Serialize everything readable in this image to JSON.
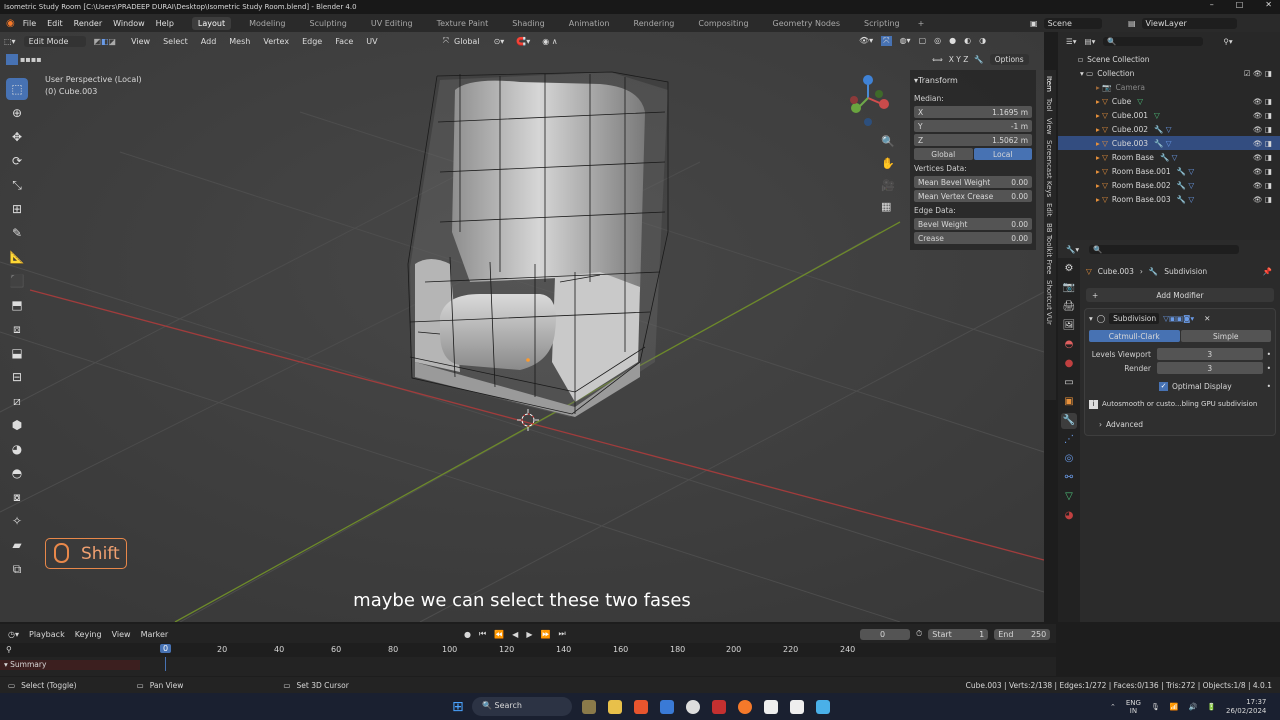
{
  "window": {
    "title": "Isometric Study Room [C:\\Users\\PRADEEP DURAI\\Desktop\\Isometric Study Room.blend] - Blender 4.0",
    "min": "–",
    "max": "□",
    "close": "✕"
  },
  "menu": [
    "File",
    "Edit",
    "Render",
    "Window",
    "Help"
  ],
  "workspaces": [
    "Layout",
    "Modeling",
    "Sculpting",
    "UV Editing",
    "Texture Paint",
    "Shading",
    "Animation",
    "Rendering",
    "Compositing",
    "Geometry Nodes",
    "Scripting"
  ],
  "scene": "Scene",
  "viewlayer": "ViewLayer",
  "viewport": {
    "mode": "Edit Mode",
    "menus": [
      "View",
      "Select",
      "Add",
      "Mesh",
      "Vertex",
      "Edge",
      "Face",
      "UV"
    ],
    "orientation": "Global",
    "perspective": "User Perspective (Local)",
    "object": "(0) Cube.003",
    "options": "Options",
    "axes": "X  Y  Z"
  },
  "transform": {
    "title": "Transform",
    "median": "Median:",
    "x_label": "X",
    "x": "1.1695 m",
    "y_label": "Y",
    "y": "-1 m",
    "z_label": "Z",
    "z": "1.5062 m",
    "global": "Global",
    "local": "Local",
    "vertices_data": "Vertices Data:",
    "mean_bevel": "Mean Bevel Weight",
    "mean_bevel_val": "0.00",
    "mean_crease": "Mean Vertex Crease",
    "mean_crease_val": "0.00",
    "edge_data": "Edge Data:",
    "bevel": "Bevel Weight",
    "bevel_val": "0.00",
    "crease": "Crease",
    "crease_val": "0.00"
  },
  "sidetabs": [
    "Item",
    "Tool",
    "View",
    "Screencast Keys",
    "Edit",
    "BB Toolkit Free",
    "Shortcut VUr"
  ],
  "outliner": {
    "root": "Scene Collection",
    "collection": "Collection",
    "items": [
      "Camera",
      "Cube",
      "Cube.001",
      "Cube.002",
      "Cube.003",
      "Room Base",
      "Room Base.001",
      "Room Base.002",
      "Room Base.003"
    ],
    "selected": "Cube.003"
  },
  "properties": {
    "object": "Cube.003",
    "modifier": "Subdivision",
    "add_modifier": "Add Modifier",
    "catmull": "Catmull-Clark",
    "simple": "Simple",
    "levels_label": "Levels Viewport",
    "levels": "3",
    "render_label": "Render",
    "render": "3",
    "optimal": "Optimal Display",
    "info": "Autosmooth or custo...bling GPU subdivision",
    "advanced": "Advanced"
  },
  "timeline": {
    "menus": [
      "Playback",
      "Keying",
      "View",
      "Marker"
    ],
    "frame": "0",
    "start_label": "Start",
    "start": "1",
    "end_label": "End",
    "end": "250",
    "ticks": [
      "0",
      "20",
      "40",
      "60",
      "80",
      "100",
      "120",
      "140",
      "160",
      "180",
      "200",
      "220",
      "240"
    ],
    "summary": "Summary"
  },
  "status": {
    "select": "Select (Toggle)",
    "pan": "Pan View",
    "cursor": "Set 3D Cursor",
    "stats": "Cube.003 | Verts:2/138 | Edges:1/272 | Faces:0/136 | Tris:272 | Objects:1/8 | 4.0.1"
  },
  "taskbar": {
    "search": "Search",
    "lang": "ENG\nIN",
    "time": "17:37",
    "date": "26/02/2024"
  },
  "caption": "maybe we can select these two fases",
  "key": "Shift"
}
